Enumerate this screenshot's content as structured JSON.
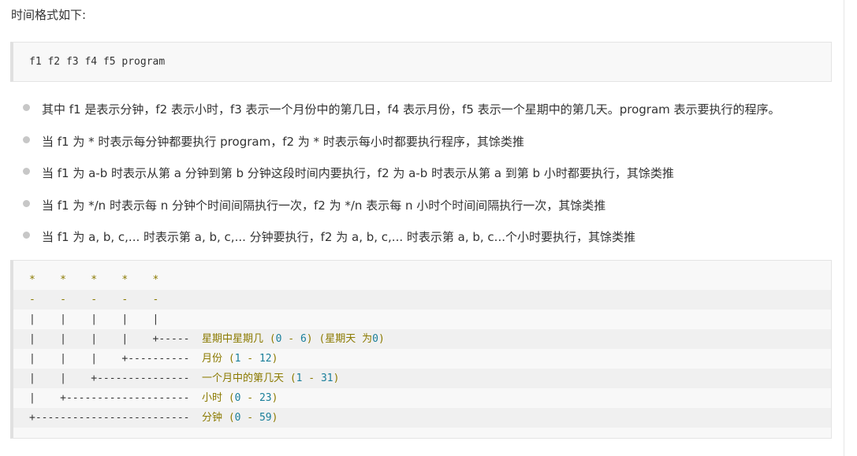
{
  "intro": "时间格式如下:",
  "format_line": "f1 f2 f3 f4 f5 program",
  "bullets": [
    "其中 f1 是表示分钟，f2 表示小时，f3 表示一个月份中的第几日，f4 表示月份，f5 表示一个星期中的第几天。program 表示要执行的程序。",
    "当 f1 为 * 时表示每分钟都要执行 program，f2 为 * 时表示每小时都要执行程序，其馀类推",
    "当 f1 为 a-b 时表示从第 a 分钟到第 b 分钟这段时间内要执行，f2 为 a-b 时表示从第 a 到第 b 小时都要执行，其馀类推",
    "当 f1 为 */n 时表示每 n 分钟个时间间隔执行一次，f2 为 */n 表示每 n 小时个时间间隔执行一次，其馀类推",
    "当 f1 为 a, b, c,... 时表示第 a, b, c,... 分钟要执行，f2 为 a, b, c,... 时表示第 a, b, c...个小时要执行，其馀类推"
  ],
  "diagram": {
    "rows": [
      {
        "art": "*    *    *    *    *",
        "label": ""
      },
      {
        "art": "-    -    -    -    -",
        "label": ""
      },
      {
        "art": "|    |    |    |    |",
        "label": ""
      },
      {
        "art": "|    |    |    |    +-----",
        "label": "星期中星期几 (0 - 6) (星期天 为0)"
      },
      {
        "art": "|    |    |    +----------",
        "label": "月份 (1 - 12)"
      },
      {
        "art": "|    |    +---------------",
        "label": "一个月中的第几天 (1 - 31)"
      },
      {
        "art": "|    +--------------------",
        "label": "小时 (0 - 23)"
      },
      {
        "art": "+-------------------------",
        "label": "分钟 (0 - 59)"
      }
    ]
  }
}
